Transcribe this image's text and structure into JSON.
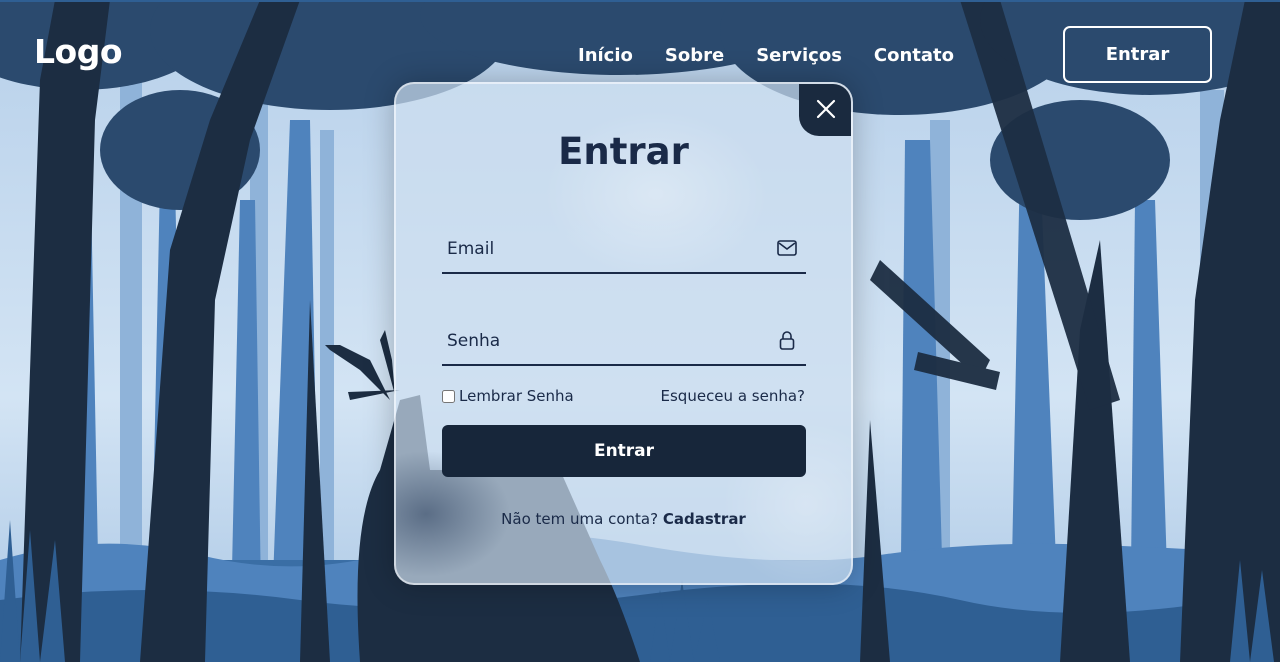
{
  "header": {
    "logo": "Logo",
    "nav": [
      {
        "label": "Início"
      },
      {
        "label": "Sobre"
      },
      {
        "label": "Serviços"
      },
      {
        "label": "Contato"
      }
    ],
    "login_button": "Entrar"
  },
  "modal": {
    "title": "Entrar",
    "email_placeholder": "Email",
    "password_placeholder": "Senha",
    "remember_label": "Lembrar Senha",
    "forgot_link": "Esqueceu a senha?",
    "submit_label": "Entrar",
    "register_prompt": "Não tem uma conta?",
    "register_link": "Cadastrar",
    "icons": {
      "close": "close-icon",
      "email": "envelope-icon",
      "password": "lock-icon"
    }
  },
  "colors": {
    "primary_dark": "#17263a",
    "title_text": "#1a2a48",
    "sky": "#c8dcef",
    "tree_dark": "#1c2d42",
    "tree_mid": "#3a6ea5",
    "tree_light": "#6f9dcc"
  }
}
